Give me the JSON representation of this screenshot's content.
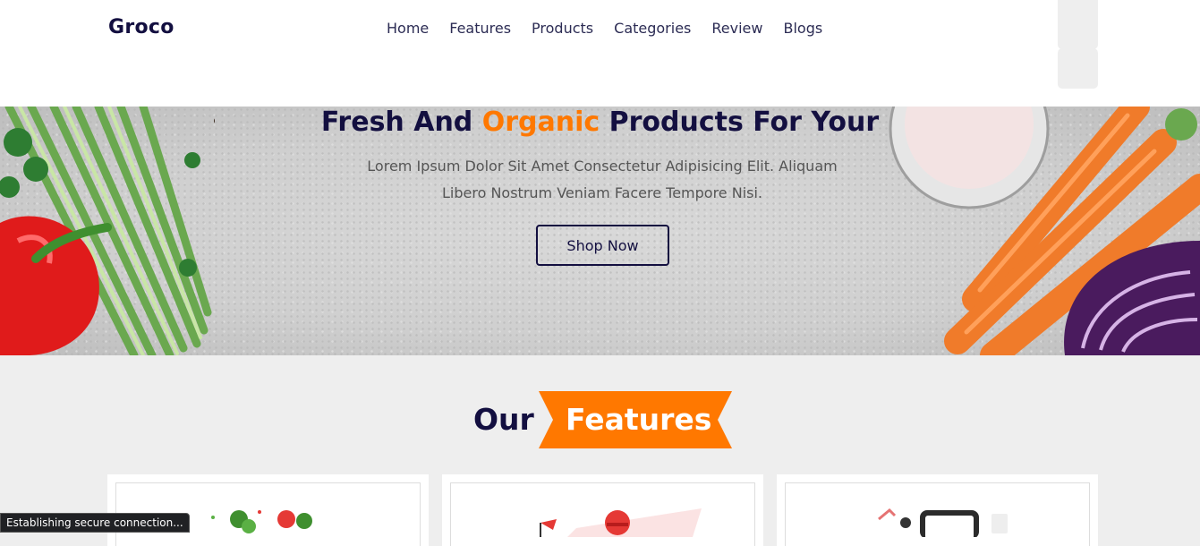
{
  "header": {
    "logo": "Groco",
    "nav": [
      "Home",
      "Features",
      "Products",
      "Categories",
      "Review",
      "Blogs"
    ]
  },
  "hero": {
    "title_pre": "Fresh And ",
    "title_accent": "Organic",
    "title_post": " Products For Your",
    "subtitle": "Lorem Ipsum Dolor Sit Amet Consectetur Adipisicing Elit. Aliquam Libero Nostrum Veniam Facere Tempore Nisi.",
    "cta": "Shop Now"
  },
  "features": {
    "heading_plain": "Our",
    "heading_accent": "Features"
  },
  "status_bar": {
    "text": "Establishing secure connection..."
  },
  "colors": {
    "accent": "#ff7800",
    "dark": "#130f40",
    "background": "#eeeeee"
  }
}
